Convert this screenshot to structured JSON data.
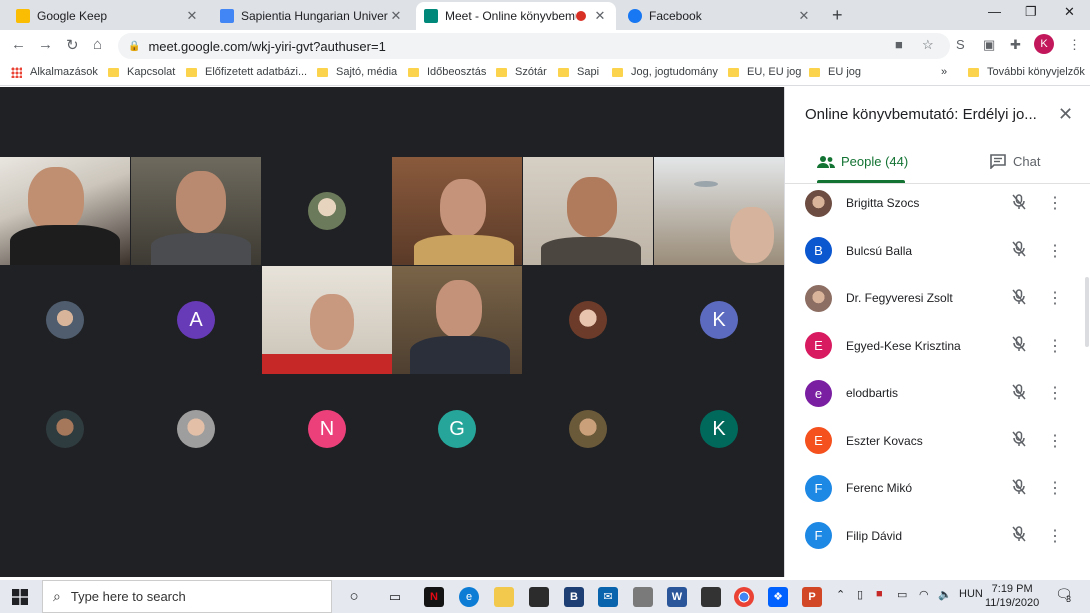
{
  "browser": {
    "tabs": [
      {
        "title": "Google Keep",
        "color": "#fbbc04"
      },
      {
        "title": "Sapientia Hungarian University o",
        "color": "#4285f4"
      },
      {
        "title": "Meet - Online könyvbemutató",
        "color": "#00897b"
      },
      {
        "title": "Facebook",
        "color": "#1877f2"
      }
    ],
    "new_tab": "+",
    "url": "meet.google.com/wkj-yiri-gvt?authuser=1",
    "profile_initial": "K",
    "bookmarks": [
      {
        "label": "Alkalmazások"
      },
      {
        "label": "Kapcsolat"
      },
      {
        "label": "Előfizetett adatbázi..."
      },
      {
        "label": "Sajtó, média"
      },
      {
        "label": "Időbeosztás"
      },
      {
        "label": "Szótár"
      },
      {
        "label": "Sapi"
      },
      {
        "label": "Jog, jogtudomány"
      },
      {
        "label": "EU, EU jog"
      },
      {
        "label": "EU jog"
      },
      {
        "label": "»"
      },
      {
        "label": "További könyvjelzők"
      }
    ]
  },
  "meet": {
    "letter_avatars": [
      {
        "letter": "A",
        "color": "#673ab7"
      },
      {
        "letter": "K",
        "color": "#5c6bc0"
      },
      {
        "letter": "N",
        "color": "#ec407a"
      },
      {
        "letter": "G",
        "color": "#26a69a"
      },
      {
        "letter": "K",
        "color": "#00695c"
      }
    ]
  },
  "panel": {
    "title": "Online könyvbemutató: Erdélyi jo...",
    "people_tab": "People (44)",
    "chat_tab": "Chat",
    "people": [
      {
        "name": "Brigitta Szocs",
        "initial": "",
        "color": "#6d4c41",
        "photo": true
      },
      {
        "name": "Bulcsú Balla",
        "initial": "B",
        "color": "#0b57d0",
        "photo": false
      },
      {
        "name": "Dr. Fegyveresi Zsolt",
        "initial": "",
        "color": "#8d6e63",
        "photo": true
      },
      {
        "name": "Egyed-Kese Krisztina",
        "initial": "E",
        "color": "#d81b60",
        "photo": false
      },
      {
        "name": "elodbartis",
        "initial": "e",
        "color": "#7b1fa2",
        "photo": false
      },
      {
        "name": "Eszter Kovacs",
        "initial": "E",
        "color": "#f4511e",
        "photo": false
      },
      {
        "name": "Ferenc Mikó",
        "initial": "F",
        "color": "#1e88e5",
        "photo": false
      },
      {
        "name": "Filip Dávid",
        "initial": "F",
        "color": "#1e88e5",
        "photo": false
      }
    ]
  },
  "taskbar": {
    "search_placeholder": "Type here to search",
    "lang": "HUN",
    "time": "7:19 PM",
    "date": "11/19/2020",
    "notification_count": "3"
  }
}
